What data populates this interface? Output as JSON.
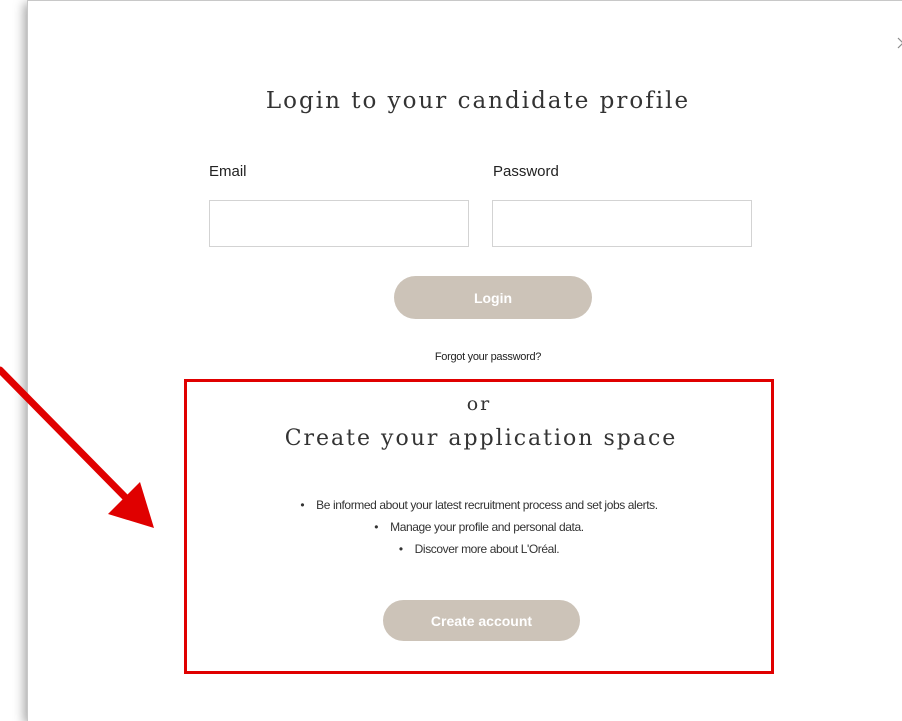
{
  "login": {
    "title": "Login to your candidate profile",
    "email_label": "Email",
    "password_label": "Password",
    "email_value": "",
    "password_value": "",
    "login_button": "Login",
    "forgot_link": "Forgot your password?"
  },
  "signup": {
    "or_text": "or",
    "title": "Create your application space",
    "bullets": [
      "Be informed about your latest recruitment process and set jobs alerts.",
      "Manage your profile and personal data.",
      "Discover more about L'Oréal."
    ],
    "create_button": "Create account"
  },
  "icons": {
    "close": "close-icon",
    "annotation_arrow": "arrow-icon"
  },
  "colors": {
    "button_bg": "#ccc3b8",
    "highlight_border": "#e00000",
    "arrow": "#e00000"
  }
}
